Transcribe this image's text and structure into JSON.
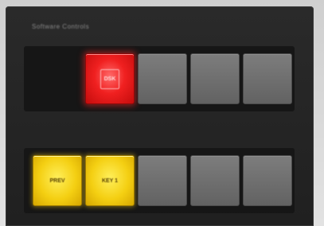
{
  "panel": {
    "title": "Software Controls"
  },
  "top_row": {
    "buttons": [
      {
        "label": "DSK",
        "state": "on-air",
        "color": "#f02020"
      },
      {
        "label": "",
        "state": "off"
      },
      {
        "label": "",
        "state": "off"
      },
      {
        "label": "",
        "state": "off"
      }
    ]
  },
  "bottom_row": {
    "buttons": [
      {
        "label": "PREV",
        "state": "selected",
        "color": "#f4cf12"
      },
      {
        "label": "KEY 1",
        "state": "selected",
        "color": "#f4cf12"
      },
      {
        "label": "",
        "state": "off"
      },
      {
        "label": "",
        "state": "off"
      },
      {
        "label": "",
        "state": "off"
      }
    ]
  }
}
